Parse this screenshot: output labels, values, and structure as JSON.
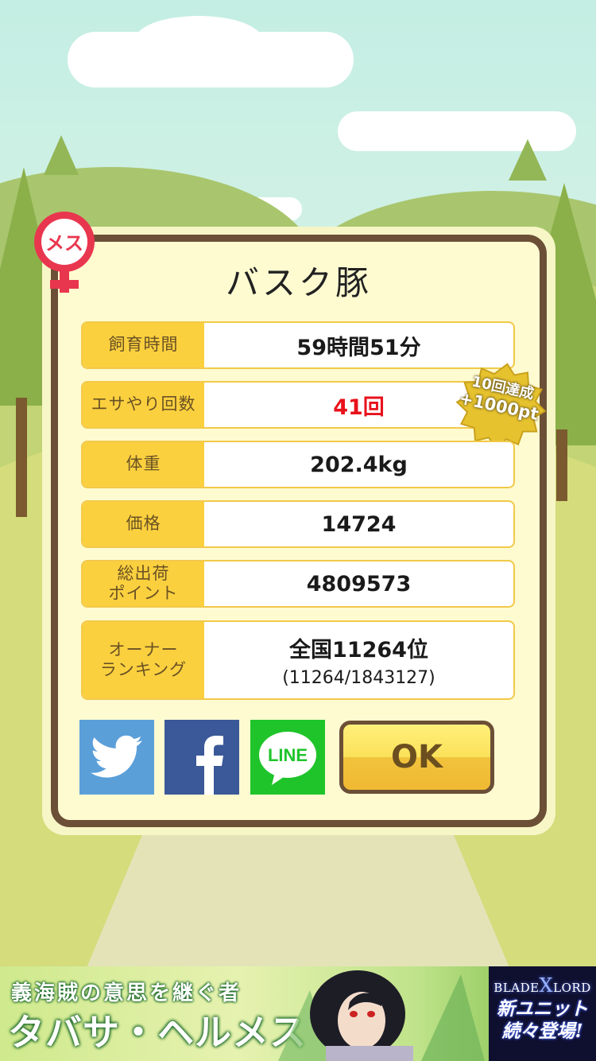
{
  "gender_badge": {
    "text": "メス",
    "icon": "female-icon",
    "color": "#e9364f"
  },
  "dialog": {
    "title": "バスク豚",
    "rows": [
      {
        "label": "飼育時間",
        "value": "59時間51分"
      },
      {
        "label": "エサやり回数",
        "value": "41回"
      },
      {
        "label": "体重",
        "value": "202.4kg"
      },
      {
        "label": "価格",
        "value": "14724"
      },
      {
        "label_line1": "総出荷",
        "label_line2": "ポイント",
        "value": "4809573"
      },
      {
        "label_line1": "オーナー",
        "label_line2": "ランキング",
        "value": "全国11264位",
        "sub_value": "(11264/1843127)"
      }
    ],
    "bonus": {
      "line1": "10回達成",
      "line2": "+1000pt"
    }
  },
  "actions": {
    "twitter_icon": "twitter-icon",
    "facebook_icon": "facebook-icon",
    "line_label": "LINE",
    "ok_label": "OK"
  },
  "ad": {
    "line1": "義海賊の意思を継ぐ者",
    "line2": "タバサ・ヘルメス",
    "logo_part1": "BLADE",
    "logo_x": "X",
    "logo_part2": "LORD",
    "tag_line1": "新ユニット",
    "tag_line2": "続々登場!"
  },
  "colors": {
    "label_bg": "#fbd03f",
    "value_highlight": "#e8121b",
    "frame": "#6b4f36",
    "twitter": "#5b9fd9",
    "facebook": "#3b5998",
    "line": "#1fc42b"
  }
}
